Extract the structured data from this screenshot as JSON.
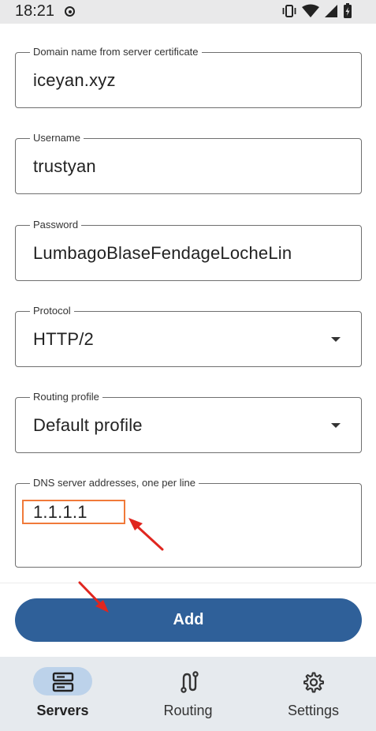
{
  "status_bar": {
    "time": "18:21"
  },
  "form": {
    "domain": {
      "label": "Domain name from server certificate",
      "value": "iceyan.xyz"
    },
    "username": {
      "label": "Username",
      "value": "trustyan"
    },
    "password": {
      "label": "Password",
      "value": "LumbagoBlaseFendageLocheLin"
    },
    "protocol": {
      "label": "Protocol",
      "value": "HTTP/2"
    },
    "routing_profile": {
      "label": "Routing profile",
      "value": "Default profile"
    },
    "dns": {
      "label": "DNS server addresses, one per line",
      "value": "1.1.1.1"
    }
  },
  "add_button": {
    "label": "Add"
  },
  "bottom_nav": {
    "items": [
      {
        "label": "Servers",
        "icon": "servers-icon",
        "active": true
      },
      {
        "label": "Routing",
        "icon": "routing-icon",
        "active": false
      },
      {
        "label": "Settings",
        "icon": "gear-icon",
        "active": false
      }
    ]
  },
  "colors": {
    "accent": "#2f6099",
    "annotation": "#e0261f",
    "highlight": "#f07a3a",
    "nav_pill": "#bcd2ea"
  }
}
